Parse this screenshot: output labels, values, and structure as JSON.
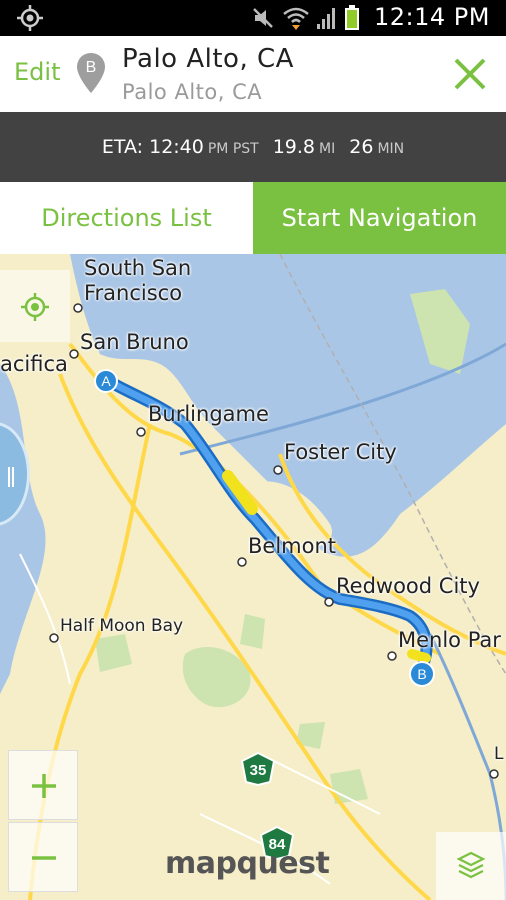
{
  "status_bar": {
    "time": "12:14 PM",
    "icons": [
      "gps-icon",
      "mute-icon",
      "wifi-icon",
      "signal-icon",
      "battery-icon"
    ]
  },
  "header": {
    "edit_label": "Edit",
    "pin_letter": "B",
    "title": "Palo Alto, CA",
    "subtitle": "Palo Alto, CA"
  },
  "eta": {
    "label": "ETA: 12:40",
    "tz": "PM PST",
    "distance": "19.8",
    "distance_unit": "MI",
    "duration": "26",
    "duration_unit": "MIN"
  },
  "actions": {
    "directions_list": "Directions List",
    "start_navigation": "Start Navigation"
  },
  "map": {
    "cities": {
      "south_sf_1": "South San",
      "south_sf_2": "Francisco",
      "san_bruno": "San Bruno",
      "pacifica": "acifica",
      "burlingame": "Burlingame",
      "foster_city": "Foster City",
      "belmont": "Belmont",
      "redwood_city": "Redwood City",
      "half_moon_bay": "Half Moon Bay",
      "menlo_park": "Menlo Par",
      "l": "L"
    },
    "marker_a": "A",
    "marker_b": "B",
    "shield_35": "35",
    "shield_84": "84",
    "zoom_in": "+",
    "zoom_out": "−",
    "logo": "mapquest"
  },
  "colors": {
    "accent": "#7ac142",
    "route": "#3b8fe0",
    "eta_bar": "#424242",
    "water": "#a9c6e6",
    "land": "#f5eec8"
  }
}
